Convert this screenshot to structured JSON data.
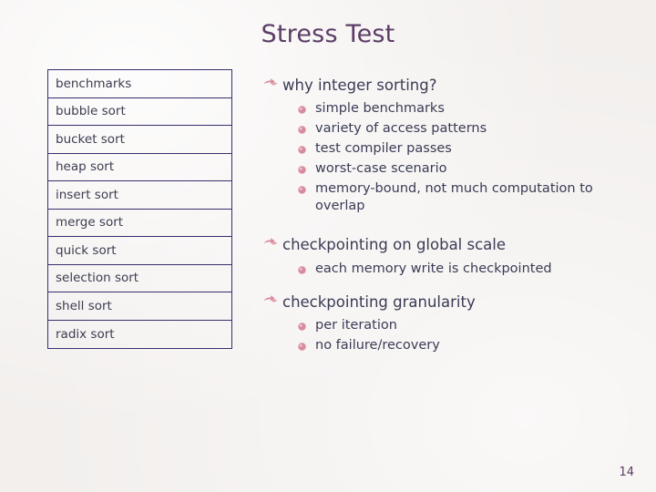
{
  "slide": {
    "title": "Stress Test",
    "page_number": "14",
    "table": {
      "name": "benchmarks-table",
      "rows": [
        "benchmarks",
        "bubble sort",
        "bucket sort",
        "heap sort",
        "insert sort",
        "merge sort",
        "quick sort",
        "selection sort",
        "shell sort",
        "radix sort"
      ]
    },
    "groups": [
      {
        "heading": "why integer sorting?",
        "items": [
          "simple benchmarks",
          "variety of access patterns",
          "test compiler passes",
          "worst-case scenario",
          "memory-bound, not much computation to overlap"
        ]
      },
      {
        "heading": "checkpointing on global scale",
        "items": [
          "each memory write is checkpointed"
        ]
      },
      {
        "heading": "checkpointing granularity",
        "items": [
          "per iteration",
          "no failure/recovery"
        ]
      }
    ],
    "colors": {
      "title": "#5b3d66",
      "table_border": "#3a2e6e",
      "bullet_accent": "#d98a9e",
      "text": "#3b3b55",
      "background": "#f2efed"
    }
  }
}
